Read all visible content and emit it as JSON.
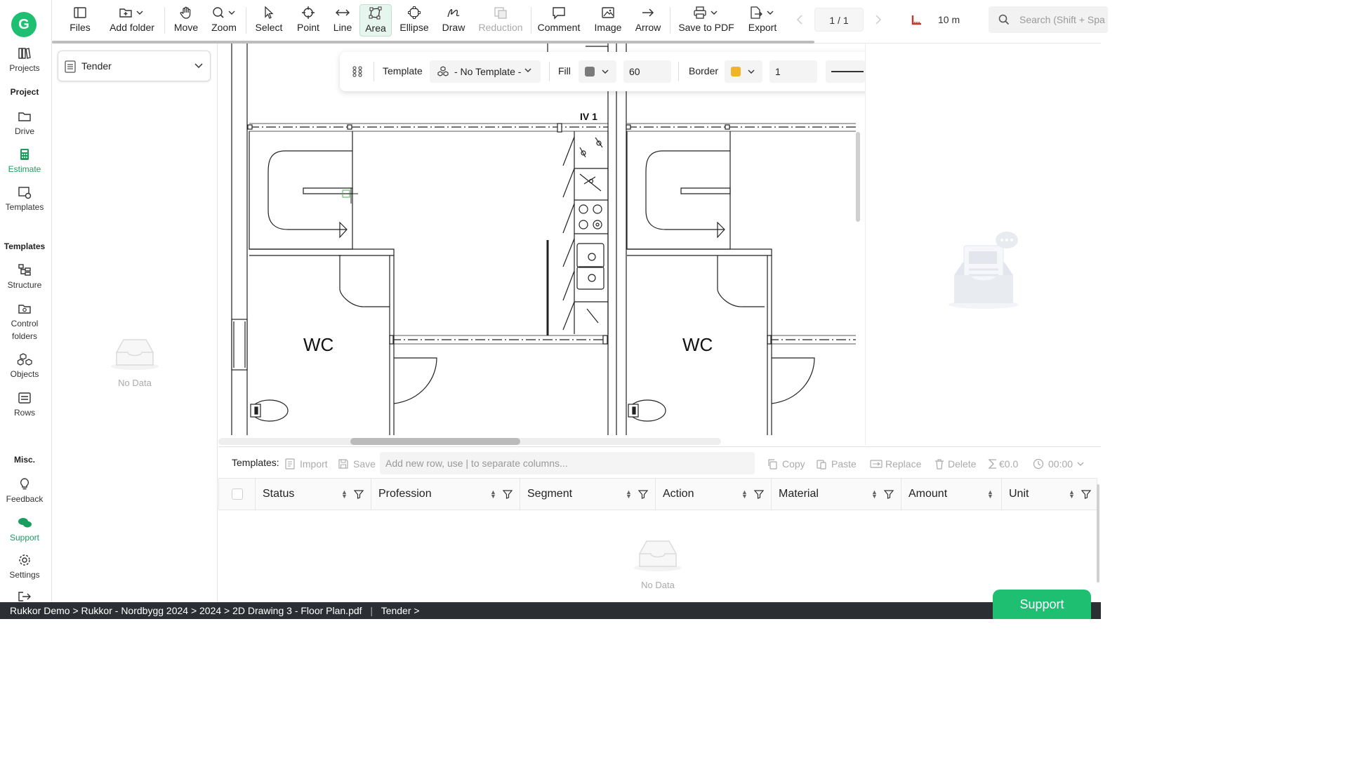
{
  "rail": {
    "logo_letter": "G",
    "items": [
      {
        "label": "Projects",
        "icon": "books-icon"
      },
      {
        "label": "Drive",
        "icon": "folder-icon"
      },
      {
        "label": "Estimate",
        "icon": "calculator-icon",
        "active": true
      },
      {
        "label": "Templates",
        "icon": "template-icon"
      },
      {
        "label": "Structure",
        "icon": "structure-icon"
      },
      {
        "label": "Control",
        "icon": "camera-folder-icon"
      },
      {
        "label": "folders",
        "icon": ""
      },
      {
        "label": "Objects",
        "icon": "cubes-icon"
      },
      {
        "label": "Rows",
        "icon": "rows-icon"
      },
      {
        "label": "Feedback",
        "icon": "lightbulb-icon"
      },
      {
        "label": "Support",
        "icon": "chat-icon"
      },
      {
        "label": "Settings",
        "icon": "gear-icon"
      }
    ],
    "sections": {
      "project": "Project",
      "templates": "Templates",
      "misc": "Misc."
    }
  },
  "toolbar": {
    "files": "Files",
    "add_folder": "Add folder",
    "move": "Move",
    "zoom": "Zoom",
    "select": "Select",
    "point": "Point",
    "line": "Line",
    "area": "Area",
    "ellipse": "Ellipse",
    "draw": "Draw",
    "reduction": "Reduction",
    "comment": "Comment",
    "image": "Image",
    "arrow": "Arrow",
    "save_pdf": "Save to PDF",
    "export": "Export",
    "page": "1 / 1",
    "scale": "10 m",
    "search_placeholder": "Search (Shift + Spa"
  },
  "left_panel": {
    "select_value": "Tender",
    "no_data": "No Data"
  },
  "float_toolbar": {
    "template_label": "Template",
    "template_value": "- No Template -",
    "fill_label": "Fill",
    "fill_color": "#7a7a7a",
    "opacity_value": "60",
    "border_label": "Border",
    "border_color": "#f0b429",
    "border_width": "1"
  },
  "drawing": {
    "room_label_1": "WC",
    "room_label_2": "WC",
    "tag": "IV 1"
  },
  "bottom": {
    "templates_label": "Templates:",
    "import": "Import",
    "save": "Save",
    "new_row_placeholder": "Add new row, use | to separate columns...",
    "copy": "Copy",
    "paste": "Paste",
    "replace": "Replace",
    "delete": "Delete",
    "sum": "€0.0",
    "time": "00:00",
    "columns": [
      "Status",
      "Profession",
      "Segment",
      "Action",
      "Material",
      "Amount",
      "Unit"
    ],
    "no_data": "No Data"
  },
  "statusbar": {
    "path": "Rukkor Demo > Rukkor - Nordbygg 2024 > 2024 > 2D Drawing 3 - Floor Plan.pdf",
    "tab": "Tender >"
  },
  "support_button": "Support",
  "colors": {
    "brand": "#1fbf72",
    "active_text": "#1a9e5f"
  }
}
